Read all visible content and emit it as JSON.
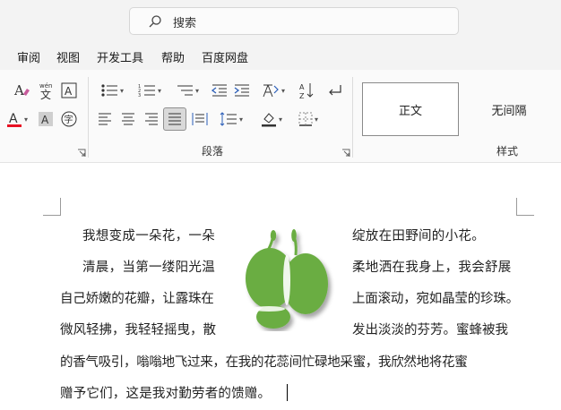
{
  "search": {
    "placeholder": "搜索"
  },
  "menu": {
    "items": [
      "审阅",
      "视图",
      "开发工具",
      "帮助",
      "百度网盘"
    ]
  },
  "ribbon": {
    "font_group": {
      "phonetic_label": "wén\n文"
    },
    "paragraph_group": {
      "label": "段落"
    },
    "styles_group": {
      "label": "样式",
      "styles": [
        "正文",
        "无间隔"
      ]
    }
  },
  "document": {
    "lines": [
      {
        "left": "我想变成一朵花，一朵",
        "right": "绽放在田野间的小花。"
      },
      {
        "left": "清晨，当第一缕阳光温",
        "right": "柔地洒在我身上，我会舒展"
      },
      {
        "left": "自己娇嫩的花瓣，让露珠在",
        "right": "上面滚动，宛如晶莹的珍珠。"
      },
      {
        "left": "微风轻拂，我轻轻摇曳，散",
        "right": "发出淡淡的芬芳。蜜蜂被我"
      },
      {
        "full": "的香气吸引，嗡嗡地飞过来，在我的花蕊间忙碌地采蜜，我欣然地将花蜜"
      },
      {
        "full": "赠予它们，这是我对勤劳者的馈赠。"
      }
    ]
  },
  "colors": {
    "accent_green": "#6aad43",
    "font_color_red": "#e81123"
  }
}
